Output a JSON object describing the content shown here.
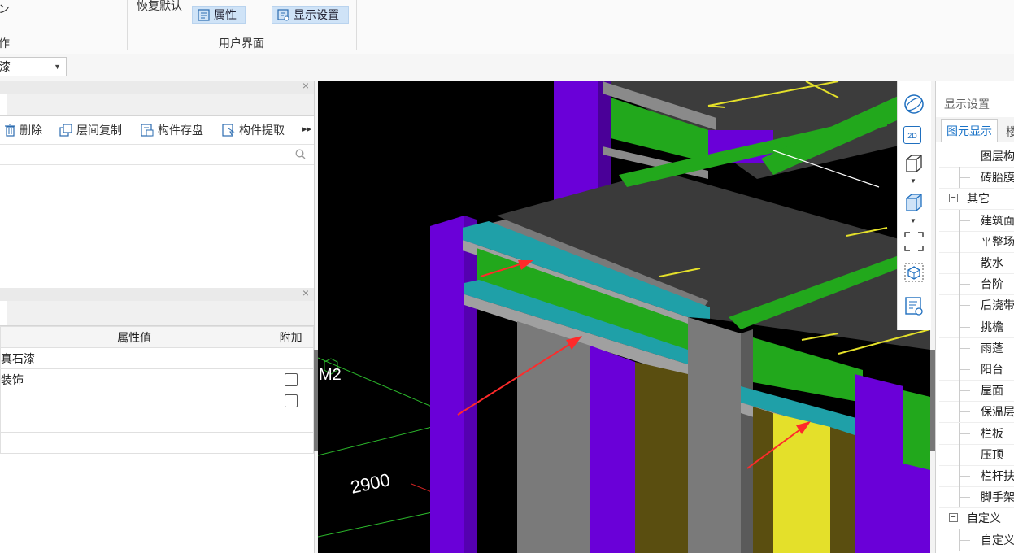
{
  "ribbon": {
    "left_stub": "ン",
    "left_group_label": "作",
    "restore_default": "恢复默认",
    "properties_button": "属性",
    "display_settings_button": "显示设置",
    "group_label": "用户界面"
  },
  "toolbar_row": {
    "material_select_value": "漆"
  },
  "component_panel": {
    "tools": [
      "删除",
      "层间复制",
      "构件存盘",
      "构件提取"
    ],
    "more_icon": "double-arrow-right-icon",
    "search_icon": "search-icon"
  },
  "property_panel": {
    "headers": {
      "value": "属性值",
      "extra": "附加"
    },
    "rows": [
      {
        "value": "真石漆",
        "checkbox": false
      },
      {
        "value": "装饰",
        "checkbox": true
      },
      {
        "value": "",
        "checkbox": true
      },
      {
        "value": "",
        "checkbox": false
      },
      {
        "value": "",
        "checkbox": false
      }
    ]
  },
  "viewport": {
    "label_m2": "M2",
    "dimension": "2900",
    "colors": {
      "background": "#000000",
      "column": "#6a00d8",
      "beam_green": "#22a81c",
      "cyan": "#1fa0a8",
      "slab": "#3a3a3a",
      "gray": "#7a7a7a",
      "yellow": "#e4e02a",
      "olive": "#5a4e10",
      "arrow": "#ff2a2a"
    }
  },
  "view_toolbar": {
    "icons": [
      "orbit-icon",
      "2d-view-icon",
      "3d-box-icon",
      "dropdown-icon",
      "3d-box-filled-icon",
      "dropdown-icon",
      "fit-view-icon",
      "local-3d-icon",
      "display-settings-icon"
    ],
    "label_2d": "2D"
  },
  "display_settings_panel": {
    "title": "显示设置",
    "tab_active": "图元显示",
    "tab_next": "楼",
    "tree": [
      {
        "label": "图层构",
        "type": "header"
      },
      {
        "label": "砖胎膜",
        "type": "leaf"
      },
      {
        "label": "其它",
        "type": "group"
      },
      {
        "label": "建筑面",
        "type": "leaf"
      },
      {
        "label": "平整场",
        "type": "leaf"
      },
      {
        "label": "散水",
        "type": "leaf"
      },
      {
        "label": "台阶",
        "type": "leaf"
      },
      {
        "label": "后浇带",
        "type": "leaf"
      },
      {
        "label": "挑檐",
        "type": "leaf"
      },
      {
        "label": "雨蓬",
        "type": "leaf"
      },
      {
        "label": "阳台",
        "type": "leaf"
      },
      {
        "label": "屋面",
        "type": "leaf"
      },
      {
        "label": "保温层",
        "type": "leaf"
      },
      {
        "label": "栏板",
        "type": "leaf"
      },
      {
        "label": "压顶",
        "type": "leaf"
      },
      {
        "label": "栏杆扶",
        "type": "leaf"
      },
      {
        "label": "脚手架",
        "type": "leaf"
      },
      {
        "label": "自定义",
        "type": "group"
      },
      {
        "label": "自定义",
        "type": "leaf"
      }
    ]
  }
}
